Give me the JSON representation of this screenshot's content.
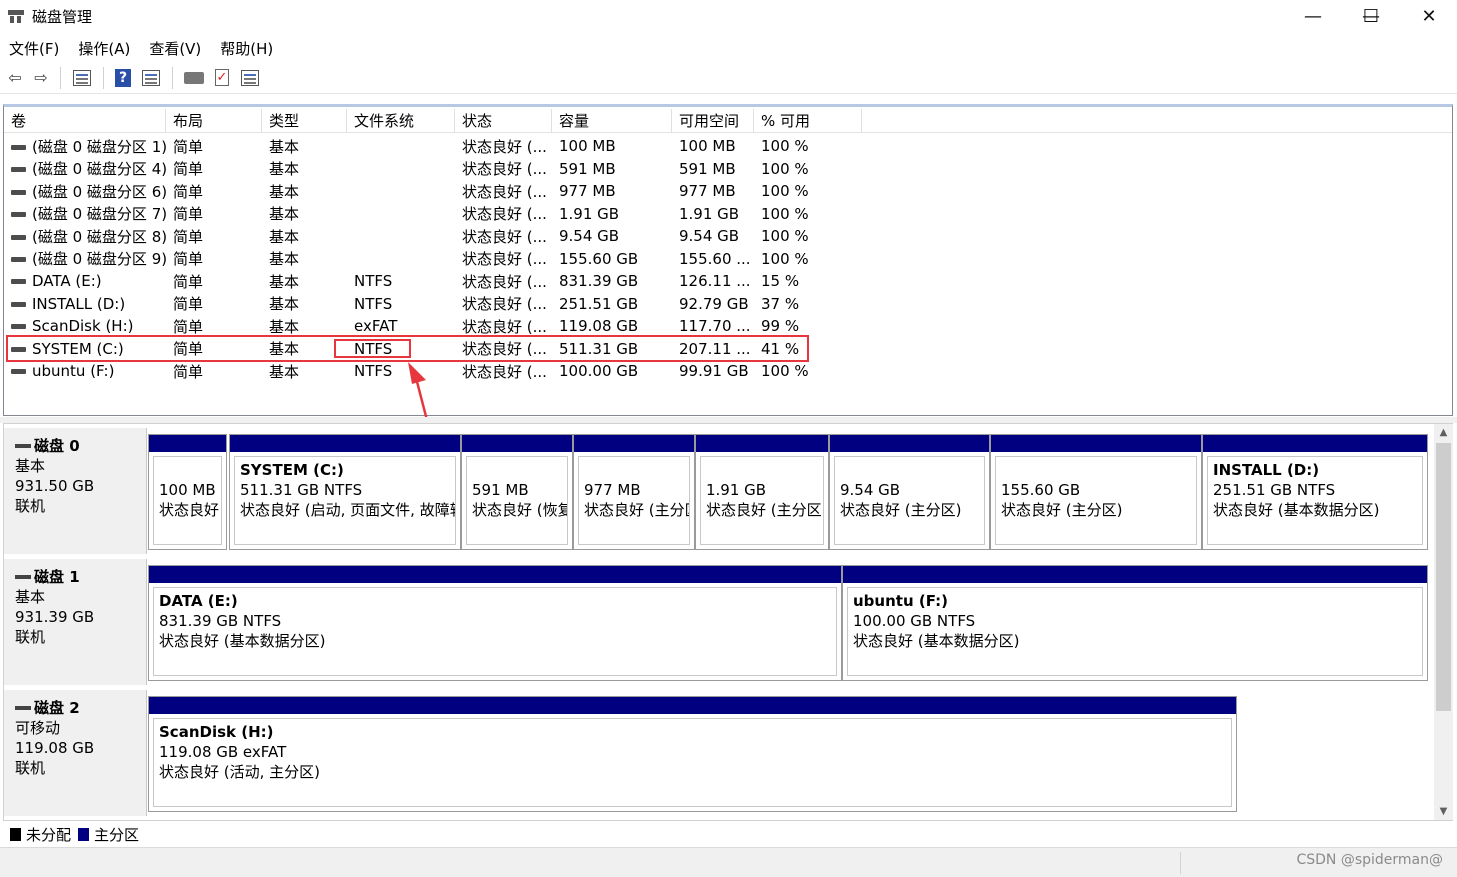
{
  "window": {
    "title": "磁盘管理",
    "min_glyph": "—",
    "max_glyph": "☐",
    "close_glyph": "✕"
  },
  "menu": [
    "文件(F)",
    "操作(A)",
    "查看(V)",
    "帮助(H)"
  ],
  "toolbar": {
    "back_glyph": "⇦",
    "forward_glyph": "⇨",
    "help_glyph": "?",
    "check_glyph": "✓",
    "icons": [
      "back-icon",
      "forward-icon",
      "console-tree-icon",
      "help-icon",
      "properties-icon",
      "disk-icon",
      "checklist-icon",
      "details-icon"
    ]
  },
  "volumes": {
    "columns": [
      "卷",
      "布局",
      "类型",
      "文件系统",
      "状态",
      "容量",
      "可用空间",
      "% 可用"
    ],
    "rows": [
      [
        "(磁盘 0 磁盘分区 1)",
        "简单",
        "基本",
        "",
        "状态良好 (...",
        "100 MB",
        "100 MB",
        "100 %"
      ],
      [
        "(磁盘 0 磁盘分区 4)",
        "简单",
        "基本",
        "",
        "状态良好 (...",
        "591 MB",
        "591 MB",
        "100 %"
      ],
      [
        "(磁盘 0 磁盘分区 6)",
        "简单",
        "基本",
        "",
        "状态良好 (...",
        "977 MB",
        "977 MB",
        "100 %"
      ],
      [
        "(磁盘 0 磁盘分区 7)",
        "简单",
        "基本",
        "",
        "状态良好 (...",
        "1.91 GB",
        "1.91 GB",
        "100 %"
      ],
      [
        "(磁盘 0 磁盘分区 8)",
        "简单",
        "基本",
        "",
        "状态良好 (...",
        "9.54 GB",
        "9.54 GB",
        "100 %"
      ],
      [
        "(磁盘 0 磁盘分区 9)",
        "简单",
        "基本",
        "",
        "状态良好 (...",
        "155.60 GB",
        "155.60 ...",
        "100 %"
      ],
      [
        "DATA (E:)",
        "简单",
        "基本",
        "NTFS",
        "状态良好 (...",
        "831.39 GB",
        "126.11 ...",
        "15 %"
      ],
      [
        "INSTALL (D:)",
        "简单",
        "基本",
        "NTFS",
        "状态良好 (...",
        "251.51 GB",
        "92.79 GB",
        "37 %"
      ],
      [
        "ScanDisk (H:)",
        "简单",
        "基本",
        "exFAT",
        "状态良好 (...",
        "119.08 GB",
        "117.70 ...",
        "99 %"
      ],
      [
        "SYSTEM (C:)",
        "简单",
        "基本",
        "NTFS",
        "状态良好 (...",
        "511.31 GB",
        "207.11 ...",
        "41 %"
      ],
      [
        "ubuntu (F:)",
        "简单",
        "基本",
        "NTFS",
        "状态良好 (...",
        "100.00 GB",
        "99.91 GB",
        "100 %"
      ]
    ],
    "highlight_color": "#e8363e"
  },
  "disks": [
    {
      "name": "磁盘 0",
      "type": "基本",
      "size": "931.50 GB",
      "status": "联机",
      "partitions": [
        {
          "title": "",
          "line1": "100 MB",
          "line2": "状态良好"
        },
        {
          "title": "SYSTEM  (C:)",
          "line1": "511.31 GB NTFS",
          "line2": "状态良好 (启动, 页面文件, 故障转"
        },
        {
          "title": "",
          "line1": "591 MB",
          "line2": "状态良好 (恢复"
        },
        {
          "title": "",
          "line1": "977 MB",
          "line2": "状态良好 (主分区"
        },
        {
          "title": "",
          "line1": "1.91 GB",
          "line2": "状态良好 (主分区"
        },
        {
          "title": "",
          "line1": "9.54 GB",
          "line2": "状态良好 (主分区)"
        },
        {
          "title": "",
          "line1": "155.60 GB",
          "line2": "状态良好 (主分区)"
        },
        {
          "title": "INSTALL  (D:)",
          "line1": "251.51 GB NTFS",
          "line2": "状态良好 (基本数据分区)"
        }
      ]
    },
    {
      "name": "磁盘 1",
      "type": "基本",
      "size": "931.39 GB",
      "status": "联机",
      "partitions": [
        {
          "title": "DATA  (E:)",
          "line1": "831.39 GB NTFS",
          "line2": "状态良好 (基本数据分区)"
        },
        {
          "title": "ubuntu  (F:)",
          "line1": "100.00 GB NTFS",
          "line2": "状态良好 (基本数据分区)"
        }
      ]
    },
    {
      "name": "磁盘 2",
      "type": "可移动",
      "size": "119.08 GB",
      "status": "联机",
      "partitions": [
        {
          "title": "ScanDisk  (H:)",
          "line1": "119.08 GB exFAT",
          "line2": "状态良好 (活动, 主分区)"
        }
      ]
    }
  ],
  "scrollbar": {
    "up_glyph": "▲",
    "down_glyph": "▼"
  },
  "legend": [
    {
      "label": "未分配",
      "color": "#000000"
    },
    {
      "label": "主分区",
      "color": "#000080"
    }
  ],
  "watermark": "CSDN @spiderman@",
  "colors": {
    "partition_bar": "#000080",
    "highlight": "#e8363e"
  }
}
